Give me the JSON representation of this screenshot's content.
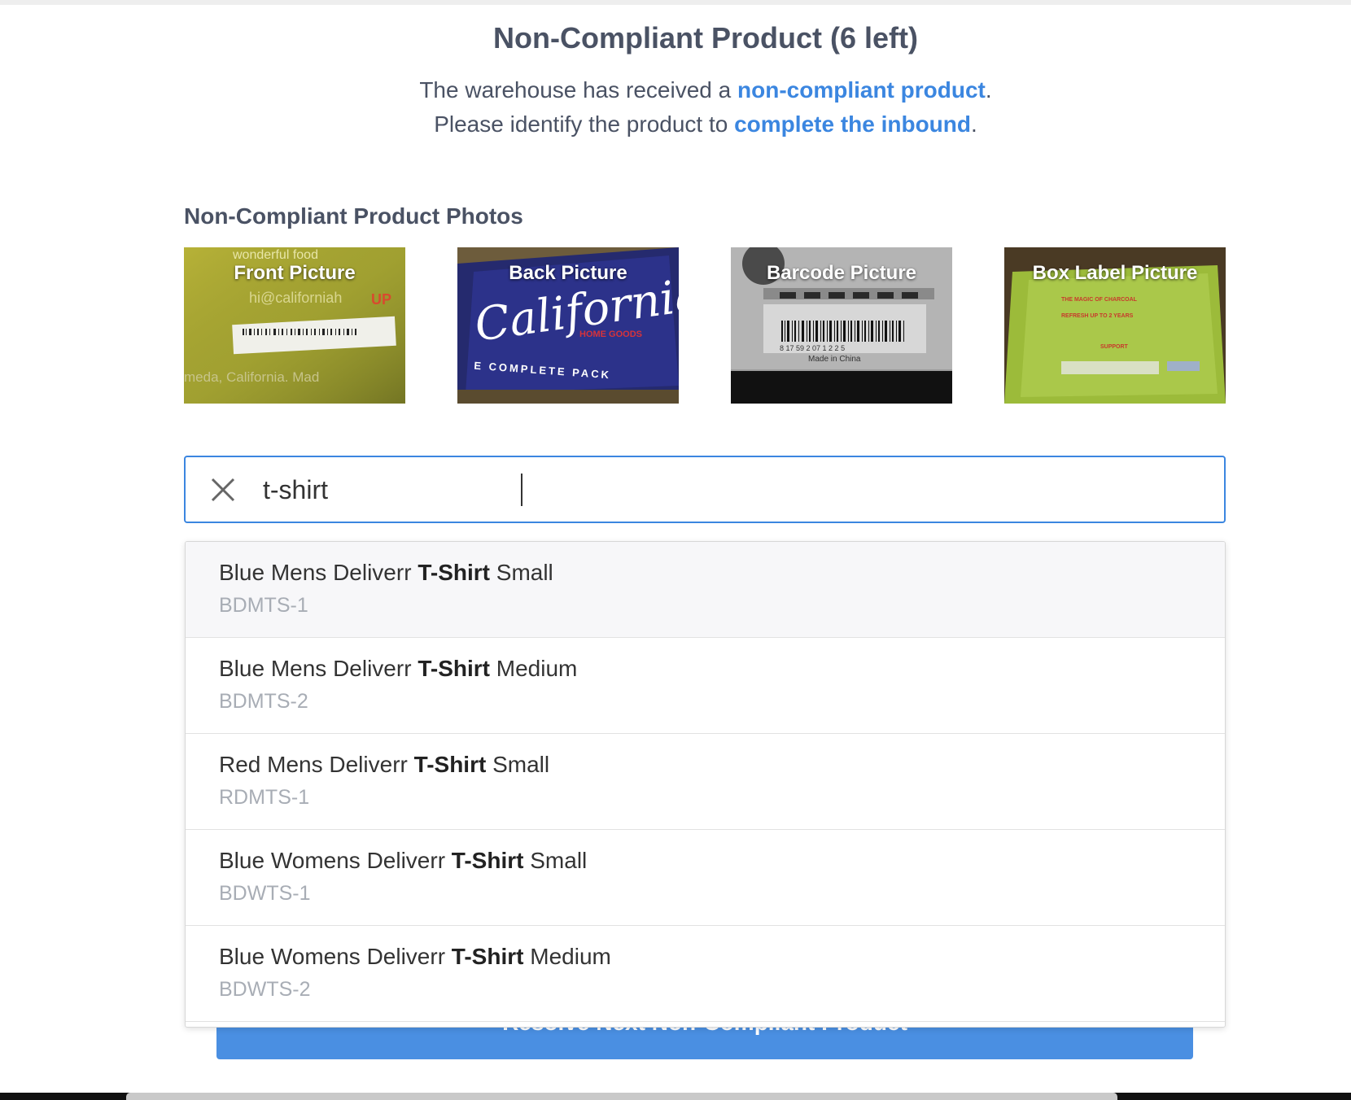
{
  "header": {
    "title": "Non-Compliant Product (6 left)",
    "line1_prefix": "The warehouse has received a ",
    "line1_link": "non-compliant product",
    "line1_suffix": ".",
    "line2_prefix": "Please identify the product to ",
    "line2_link": "complete the inbound",
    "line2_suffix": "."
  },
  "photos": {
    "section_label": "Non-Compliant Product Photos",
    "items": [
      {
        "label": "Front Picture"
      },
      {
        "label": "Back Picture"
      },
      {
        "label": "Barcode Picture"
      },
      {
        "label": "Box Label Picture"
      }
    ],
    "lettering": {
      "front_top": "wonderful food",
      "front_email": "hi@californiah",
      "front_bottom": "meda, California. Mad",
      "back_brand": "California",
      "back_sub": "HOME GOODS",
      "back_bottom": "E COMPLETE PACK",
      "barcode_digits": "8 17 59 2 07 1 2 2 5",
      "barcode_made": "Made in China",
      "box_line1": "THE MAGIC OF CHARCOAL",
      "box_line2": "REFRESH UP TO 2 YEARS",
      "box_line3": "SUPPORT"
    }
  },
  "search": {
    "value": "t-shirt",
    "clear_icon": "close-icon"
  },
  "results": [
    {
      "prefix": "Blue Mens Deliverr ",
      "match": "T-Shirt",
      "suffix": " Small",
      "sku": "BDMTS-1"
    },
    {
      "prefix": "Blue Mens Deliverr ",
      "match": "T-Shirt",
      "suffix": " Medium",
      "sku": "BDMTS-2"
    },
    {
      "prefix": "Red Mens Deliverr ",
      "match": "T-Shirt",
      "suffix": " Small",
      "sku": "RDMTS-1"
    },
    {
      "prefix": "Blue Womens Deliverr ",
      "match": "T-Shirt",
      "suffix": " Small",
      "sku": "BDWTS-1"
    },
    {
      "prefix": "Blue Womens Deliverr ",
      "match": "T-Shirt",
      "suffix": " Medium",
      "sku": "BDWTS-2"
    }
  ],
  "submit": {
    "label": "Resolve Next Non-Compliant Product"
  },
  "colors": {
    "accent": "#3b86e0",
    "button": "#4a8fe2",
    "heading": "#4a5264"
  }
}
